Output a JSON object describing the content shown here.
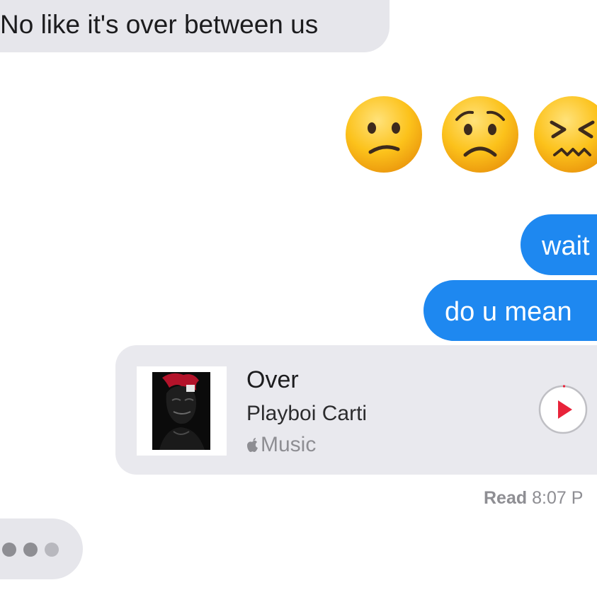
{
  "conversation": {
    "messages": [
      {
        "sender": "them",
        "text": "No like it's over between us"
      },
      {
        "sender": "me",
        "emojis": [
          "confused-face",
          "worried-face",
          "confounded-face"
        ]
      },
      {
        "sender": "me",
        "text": "wait"
      },
      {
        "sender": "me",
        "text": "do u mean"
      }
    ],
    "music_card": {
      "song_title": "Over",
      "artist": "Playboi Carti",
      "source_label": "Music",
      "source_icon": "apple-logo-icon",
      "action_icon": "play-icon"
    },
    "read_receipt": {
      "status": "Read",
      "time": "8:07 P"
    },
    "typing_indicator": {
      "icon": "typing-dots-icon"
    }
  },
  "colors": {
    "incoming_bubble": "#e6e6eb",
    "outgoing_bubble": "#1e88f0",
    "play_accent": "#e8233a",
    "secondary_text": "#8e8e93"
  }
}
